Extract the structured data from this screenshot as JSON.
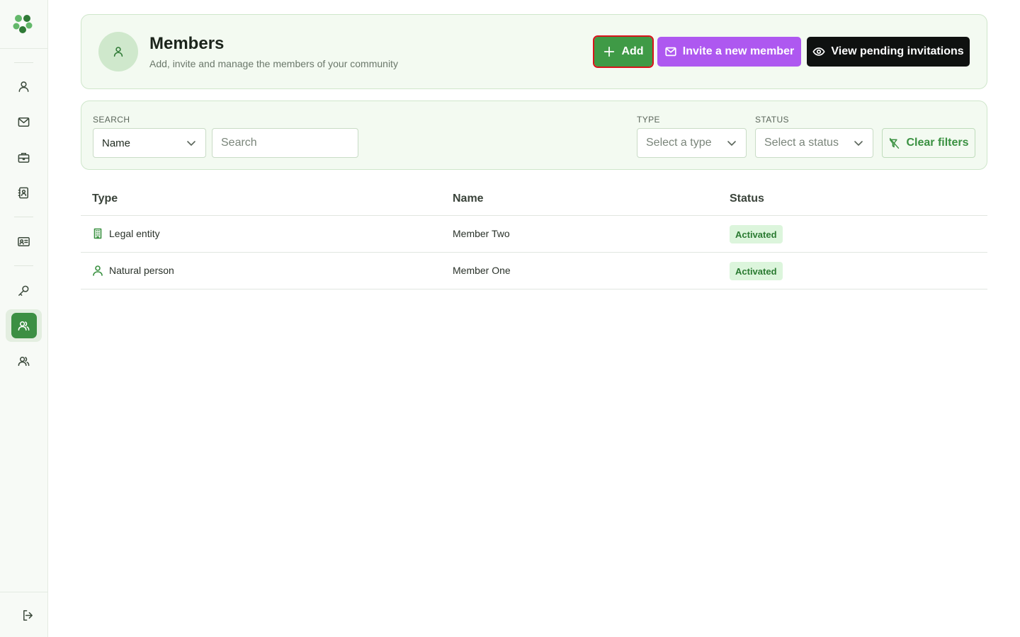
{
  "sidebar": {
    "logo": "app-logo",
    "items": [
      {
        "icon": "user-icon",
        "name": "sidebar-item-profile"
      },
      {
        "icon": "mail-icon",
        "name": "sidebar-item-messages"
      },
      {
        "icon": "briefcase-icon",
        "name": "sidebar-item-organizations"
      },
      {
        "icon": "contact-book-icon",
        "name": "sidebar-item-contacts"
      },
      {
        "icon": "id-card-icon",
        "name": "sidebar-item-credentials"
      },
      {
        "icon": "key-icon",
        "name": "sidebar-item-keys"
      },
      {
        "icon": "users-icon",
        "name": "sidebar-item-members",
        "active": true
      },
      {
        "icon": "users-icon",
        "name": "sidebar-item-groups"
      }
    ],
    "logout_icon": "logout-icon"
  },
  "header": {
    "title": "Members",
    "subtitle": "Add, invite and manage the members of your community",
    "add_label": "Add",
    "invite_label": "Invite a new member",
    "pending_label": "View pending invitations"
  },
  "filters": {
    "search_label": "SEARCH",
    "search_by": "Name",
    "search_placeholder": "Search",
    "type_label": "TYPE",
    "type_placeholder": "Select a type",
    "status_label": "STATUS",
    "status_placeholder": "Select a status",
    "clear_label": "Clear filters"
  },
  "table": {
    "columns": [
      "Type",
      "Name",
      "Status"
    ],
    "rows": [
      {
        "type": "Legal entity",
        "type_icon": "building-icon",
        "name": "Member Two",
        "status": "Activated"
      },
      {
        "type": "Natural person",
        "type_icon": "user-icon",
        "name": "Member One",
        "status": "Activated"
      }
    ]
  },
  "colors": {
    "accent": "#3f9a46",
    "invite": "#ae58f0",
    "dark": "#0f1110",
    "badge_bg": "#dcf5dc",
    "badge_text": "#2a7a31"
  }
}
